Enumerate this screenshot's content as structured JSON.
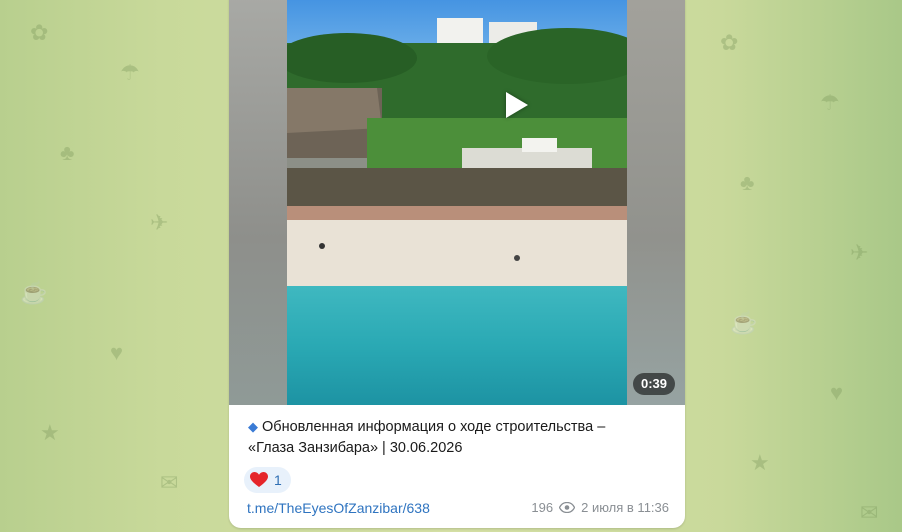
{
  "post": {
    "video_duration": "0:39",
    "caption_prefix_icon": "blue-diamond-icon",
    "caption_line1": "Обновленная информация о ходе строительства –",
    "caption_line2": "«Глаза Занзибара» | 30.06.2026",
    "reaction": {
      "emoji": "heart-icon",
      "count": "1"
    },
    "link": "t.me/TheEyesOfZanzibar/638",
    "views": "196",
    "views_icon": "eye-icon",
    "date": "2 июля в 11:36"
  },
  "colors": {
    "link": "#2f74c0",
    "reaction_bg": "#e8f1fb",
    "meta": "#8a8f94"
  }
}
